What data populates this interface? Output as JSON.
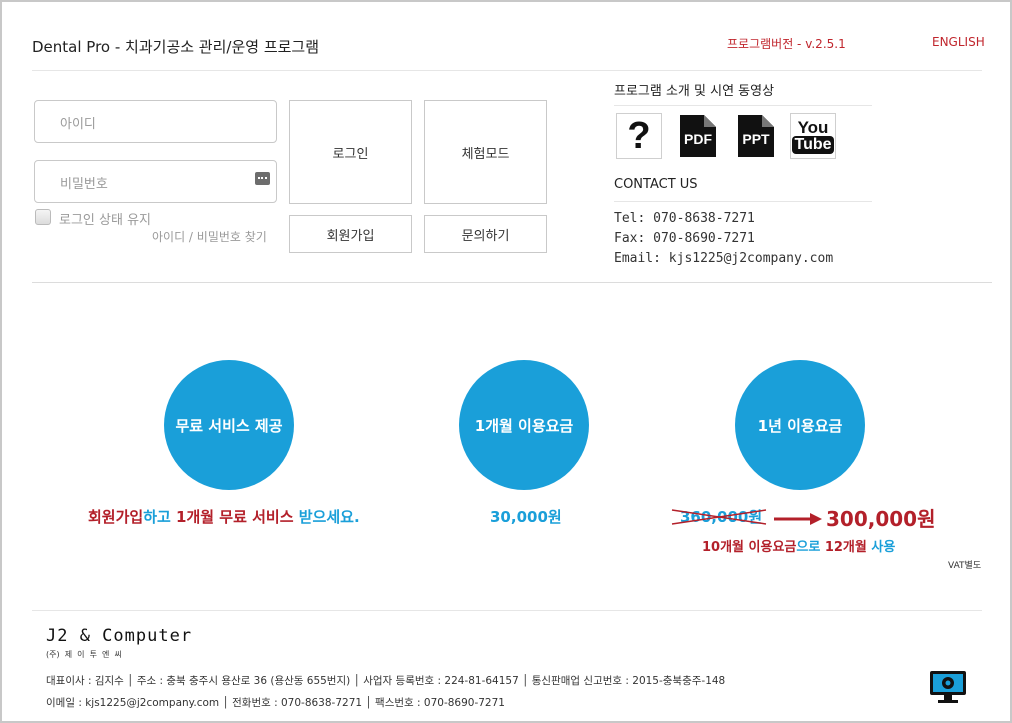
{
  "header": {
    "title": "Dental Pro - 치과기공소 관리/운영 프로그램",
    "version": "프로그램버전 - v.2.5.1",
    "language_link": "ENGLISH"
  },
  "login": {
    "id_placeholder": "아이디",
    "pw_placeholder": "비밀번호",
    "login_button": "로그인",
    "trial_button": "체험모드",
    "signup_button": "회원가입",
    "inquiry_button": "문의하기",
    "remember_label": "로그인 상태 유지",
    "find_link": "아이디 / 비밀번호 찾기"
  },
  "intro": {
    "heading": "프로그램 소개 및 시연 동영상",
    "icons": [
      {
        "name": "help-icon",
        "label": "?"
      },
      {
        "name": "pdf-icon",
        "label": "PDF"
      },
      {
        "name": "ppt-icon",
        "label": "PPT"
      },
      {
        "name": "youtube-icon",
        "label_top": "You",
        "label_bottom": "Tube"
      }
    ]
  },
  "contact": {
    "heading": "CONTACT US",
    "tel": "Tel: 070-8638-7271",
    "fax": "Fax: 070-8690-7271",
    "email": "Email: kjs1225@j2company.com"
  },
  "pricing": {
    "free": {
      "circle_label": "무료 서비스 제공",
      "desc_part1": "회원가입",
      "desc_part2": "하고 ",
      "desc_part3": "1개월 무료 서비스",
      "desc_part4": " 받으세요."
    },
    "monthly": {
      "circle_label": "1개월 이용요금",
      "price": "30,000원"
    },
    "yearly": {
      "circle_label": "1년 이용요금",
      "old_price": "360,000원",
      "new_price": "300,000원",
      "desc_part1": "10개월 이용요금",
      "desc_part2": "으로 ",
      "desc_part3": "12개월",
      "desc_part4": " 사용"
    },
    "vat_note": "VAT별도"
  },
  "footer": {
    "logo_text": "J2 & Computer",
    "logo_sub": "(주)  제  이  투  엔  씨",
    "line1": "대표이사 : 김지수 │ 주소 : 충북 충주시 용산로 36 (용산동 655번지) │ 사업자 등록번호 : 224-81-64157 │ 통신판매업 신고번호 : 2015-충북충주-148",
    "line2": "이메일 : kjs1225@j2company.com │ 전화번호 : 070-8638-7271 │ 팩스번호 : 070-8690-7271"
  },
  "colors": {
    "accent_blue": "#1a9fd9",
    "accent_red": "#b3202a"
  }
}
